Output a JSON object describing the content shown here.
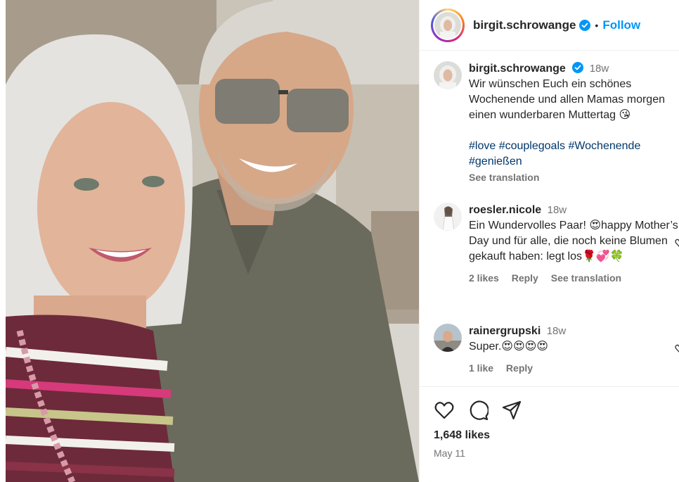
{
  "post": {
    "username": "birgit.schrowange",
    "dot": "•",
    "follow_label": "Follow",
    "caption_time": "18w",
    "caption_text": "Wir wünschen Euch ein schönes Wochenende und allen Mamas morgen einen wunderbaren Muttertag 😘",
    "hashtags": "#love #couplegoals #Wochenende #genießen",
    "see_translation": "See translation",
    "likes": "1,648 likes",
    "date": "May 11"
  },
  "comments": [
    {
      "username": "roesler.nicole",
      "time": "18w",
      "text": "Ein Wundervolles Paar! 😍happy Mother’s Day und für alle, die noch keine Blumen gekauft haben: legt los🌹💞🍀",
      "likes": "2 likes",
      "reply": "Reply",
      "see_translation": "See translation"
    },
    {
      "username": "rainergrupski",
      "time": "18w",
      "text": "Super.😍😍😍😍",
      "likes": "1 like",
      "reply": "Reply"
    }
  ],
  "colors": {
    "accent": "#0095f6",
    "hashtag": "#00376b",
    "muted": "#737373",
    "text": "#262626"
  },
  "icons": [
    "verified-badge-icon",
    "heart-icon",
    "comment-icon",
    "share-icon"
  ]
}
